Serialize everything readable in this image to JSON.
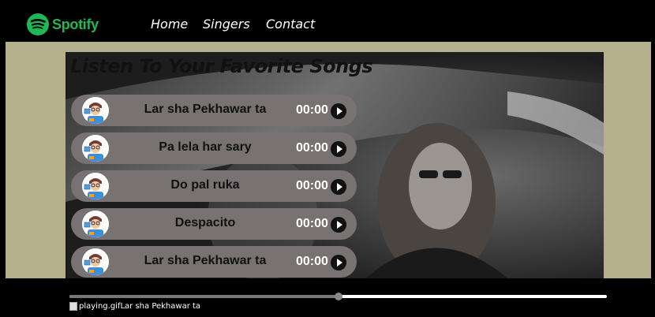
{
  "nav": {
    "brand": "Spotify",
    "links": [
      "Home",
      "Singers",
      "Contact"
    ]
  },
  "hero": {
    "title": "Listen To Your Favorite Songs"
  },
  "songs": [
    {
      "name": "Lar sha Pekhawar ta",
      "time": "00:00"
    },
    {
      "name": "Pa lela har sary",
      "time": "00:00"
    },
    {
      "name": "Do pal ruka",
      "time": "00:00"
    },
    {
      "name": "Despacito",
      "time": "00:00"
    },
    {
      "name": "Lar sha Pekhawar ta",
      "time": "00:00"
    }
  ],
  "player": {
    "progress_percent": 50,
    "gif_alt": "playing.gif",
    "current_song": "Lar sha Pekhawar ta"
  },
  "colors": {
    "brand_green": "#1DB954",
    "page_bg": "#b5b08c",
    "song_item_bg": "#787272"
  },
  "icons": [
    "spotify-logo-icon",
    "play-icon",
    "avatar-icon",
    "broken-image-icon"
  ]
}
